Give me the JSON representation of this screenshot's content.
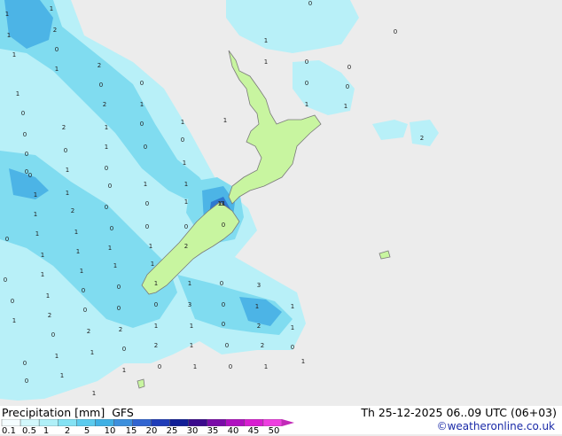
{
  "map": {
    "colors": {
      "ocean": "#ececec",
      "land": "#c8f5a0",
      "coast": "#7a7a7a",
      "precip_very_light": "#b8f0f8",
      "precip_light": "#80dcf0",
      "precip_moderate": "#4cb4e6",
      "precip_heavy": "#2e78d0"
    },
    "point_values": [
      "1",
      "0",
      "1",
      "2",
      "0",
      "1",
      "1",
      "0",
      "1",
      "1",
      "0",
      "2",
      "0",
      "1",
      "0",
      "0",
      "0",
      "0",
      "1",
      "2",
      "1",
      "1",
      "1",
      "0",
      "1",
      "1",
      "0",
      "2",
      "0",
      "1",
      "0",
      "2",
      "0",
      "1",
      "0",
      "0",
      "0",
      "1",
      "0",
      "1",
      "0",
      "1",
      "1",
      "1",
      "0",
      "1",
      "0",
      "1",
      "1",
      "0",
      "0",
      "2",
      "1",
      "0",
      "0",
      "0",
      "0",
      "0",
      "1",
      "11",
      "1",
      "1",
      "1",
      "1",
      "1",
      "1",
      "2",
      "0",
      "1",
      "1",
      "0",
      "1",
      "1",
      "0",
      "3",
      "0",
      "1",
      "0",
      "0",
      "0",
      "3",
      "0",
      "1",
      "1",
      "1",
      "2",
      "0",
      "2",
      "1",
      "1",
      "0",
      "2",
      "1",
      "0",
      "2",
      "0",
      "2",
      "1",
      "0",
      "2",
      "0",
      "1",
      "1",
      "0",
      "1",
      "1",
      "0",
      "1",
      "0",
      "1",
      "1",
      "0",
      "1"
    ]
  },
  "legend": {
    "title": "Precipitation [mm]",
    "model": "GFS",
    "colors": [
      "#f4fdff",
      "#d2f8fc",
      "#b0f0f8",
      "#84e2f4",
      "#5ccbee",
      "#3fb0e4",
      "#3c8fdc",
      "#3064d0",
      "#1f3cb8",
      "#101e96",
      "#3a0a8c",
      "#7a0ca8",
      "#b010c0",
      "#d81ed0",
      "#ee3ee0",
      "#c22ab8"
    ],
    "ticks": [
      "0.1",
      "0.5",
      "1",
      "2",
      "5",
      "10",
      "15",
      "20",
      "25",
      "30",
      "35",
      "40",
      "45",
      "50"
    ]
  },
  "footer": {
    "datetime": "Th 25-12-2025 06..09 UTC (06+03)",
    "credit": "©weatheronline.co.uk"
  }
}
